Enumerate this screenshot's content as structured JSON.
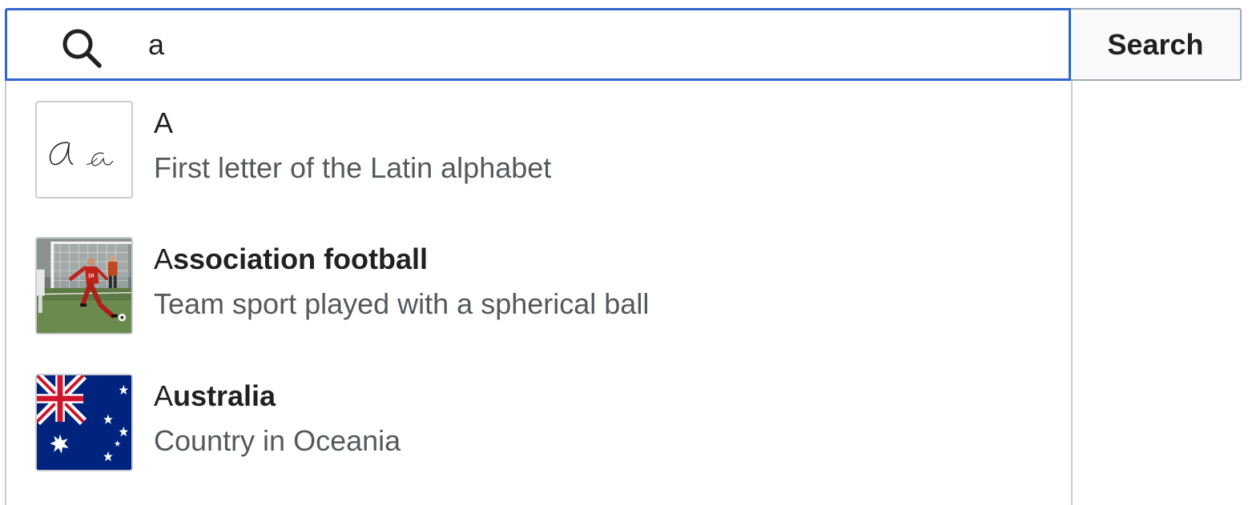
{
  "search": {
    "value": "a",
    "button_label": "Search"
  },
  "suggestions": [
    {
      "title_match": "A",
      "title_rest": "",
      "description": "First letter of the Latin alphabet",
      "thumbnail": "cursive-a-glyphs"
    },
    {
      "title_match": "A",
      "title_rest": "ssociation football",
      "description": "Team sport played with a spherical ball",
      "thumbnail": "football-player-photo"
    },
    {
      "title_match": "A",
      "title_rest": "ustralia",
      "description": "Country in Oceania",
      "thumbnail": "australia-flag"
    }
  ],
  "colors": {
    "focus_border": "#3366cc",
    "button_bg": "#f8f9fa",
    "border": "#a2a9b1",
    "description": "#54595d",
    "flag_blue": "#00247d",
    "flag_red": "#cf142b"
  }
}
